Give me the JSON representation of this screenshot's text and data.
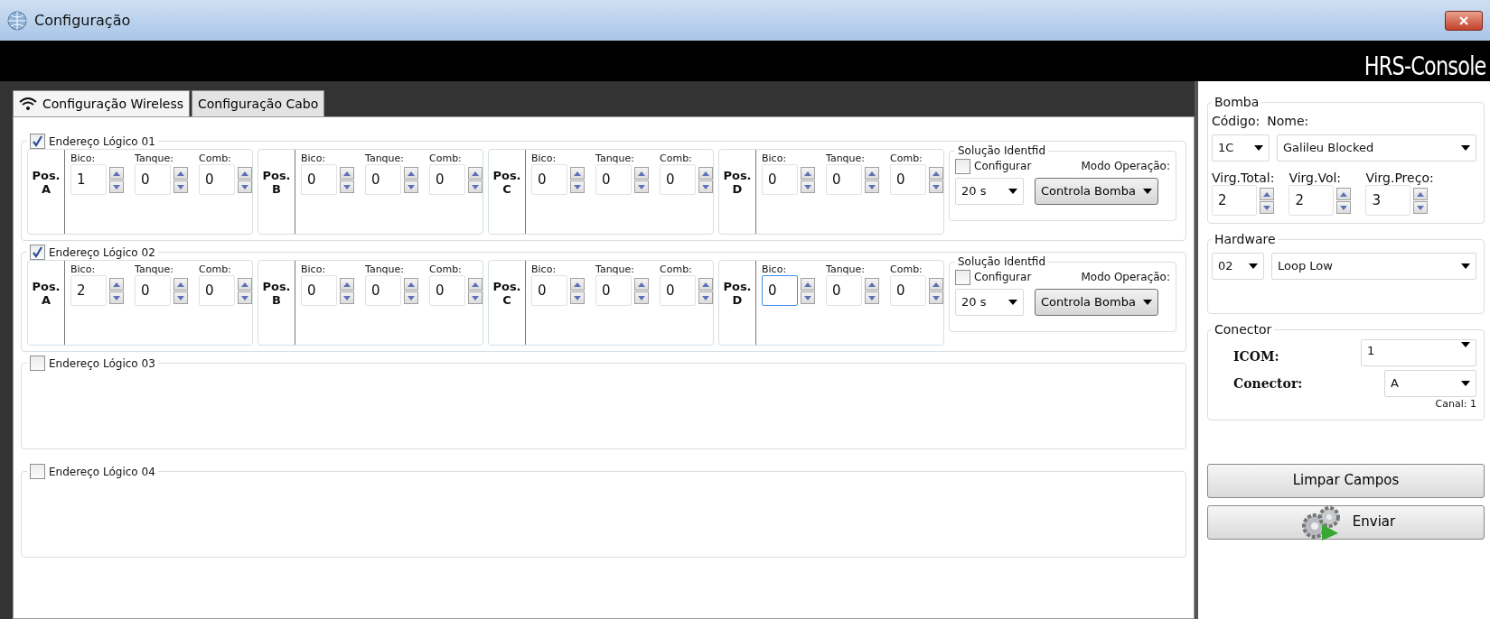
{
  "window": {
    "title": "Configuração"
  },
  "header": {
    "brand": "HRS-Console"
  },
  "tabs": [
    {
      "label": "Configuração Wireless",
      "selected": true,
      "kind": "wifi"
    },
    {
      "label": "Configuração Cabo",
      "selected": false,
      "kind": "plain"
    }
  ],
  "groups": [
    {
      "label": "Endereço Lógico 01",
      "checked": true,
      "positions": [
        {
          "pos_label": "Pos.",
          "letter": "A",
          "fields": [
            {
              "label": "Bico:",
              "value": "1",
              "focused": false
            },
            {
              "label": "Tanque:",
              "value": "0",
              "focused": false
            },
            {
              "label": "Comb:",
              "value": "0",
              "focused": false
            }
          ]
        },
        {
          "pos_label": "Pos.",
          "letter": "B",
          "fields": [
            {
              "label": "Bico:",
              "value": "0",
              "focused": false
            },
            {
              "label": "Tanque:",
              "value": "0",
              "focused": false
            },
            {
              "label": "Comb:",
              "value": "0",
              "focused": false
            }
          ]
        },
        {
          "pos_label": "Pos.",
          "letter": "C",
          "fields": [
            {
              "label": "Bico:",
              "value": "0",
              "focused": false
            },
            {
              "label": "Tanque:",
              "value": "0",
              "focused": false
            },
            {
              "label": "Comb:",
              "value": "0",
              "focused": false
            }
          ]
        },
        {
          "pos_label": "Pos.",
          "letter": "D",
          "fields": [
            {
              "label": "Bico:",
              "value": "0",
              "focused": false
            },
            {
              "label": "Tanque:",
              "value": "0",
              "focused": false
            },
            {
              "label": "Comb:",
              "value": "0",
              "focused": false
            }
          ]
        }
      ],
      "solution": {
        "legend": "Solução Identfid",
        "configure_label": "Configurar",
        "configure_checked": false,
        "mode_label": "Modo Operação:",
        "timeout": "20 s",
        "mode": "Controla Bomba"
      }
    },
    {
      "label": "Endereço Lógico 02",
      "checked": true,
      "positions": [
        {
          "pos_label": "Pos.",
          "letter": "A",
          "fields": [
            {
              "label": "Bico:",
              "value": "2",
              "focused": false
            },
            {
              "label": "Tanque:",
              "value": "0",
              "focused": false
            },
            {
              "label": "Comb:",
              "value": "0",
              "focused": false
            }
          ]
        },
        {
          "pos_label": "Pos.",
          "letter": "B",
          "fields": [
            {
              "label": "Bico:",
              "value": "0",
              "focused": false
            },
            {
              "label": "Tanque:",
              "value": "0",
              "focused": false
            },
            {
              "label": "Comb:",
              "value": "0",
              "focused": false
            }
          ]
        },
        {
          "pos_label": "Pos.",
          "letter": "C",
          "fields": [
            {
              "label": "Bico:",
              "value": "0",
              "focused": false
            },
            {
              "label": "Tanque:",
              "value": "0",
              "focused": false
            },
            {
              "label": "Comb:",
              "value": "0",
              "focused": false
            }
          ]
        },
        {
          "pos_label": "Pos.",
          "letter": "D",
          "fields": [
            {
              "label": "Bico:",
              "value": "0",
              "focused": true
            },
            {
              "label": "Tanque:",
              "value": "0",
              "focused": false
            },
            {
              "label": "Comb:",
              "value": "0",
              "focused": false
            }
          ]
        }
      ],
      "solution": {
        "legend": "Solução Identfid",
        "configure_label": "Configurar",
        "configure_checked": false,
        "mode_label": "Modo Operação:",
        "timeout": "20 s",
        "mode": "Controla Bomba"
      }
    },
    {
      "label": "Endereço Lógico 03",
      "checked": false
    },
    {
      "label": "Endereço Lógico 04",
      "checked": false
    }
  ],
  "bomba": {
    "legend": "Bomba",
    "code_label": "Código:",
    "name_label": "Nome:",
    "code": "1C",
    "name": "Galileu Blocked",
    "spinners": [
      {
        "label": "Virg.Total:",
        "value": "2"
      },
      {
        "label": "Virg.Vol:",
        "value": "2"
      },
      {
        "label": "Virg.Preço:",
        "value": "3"
      }
    ]
  },
  "hardware": {
    "legend": "Hardware",
    "code": "02",
    "model": "Loop Low"
  },
  "conector": {
    "legend": "Conector",
    "icom_label": "ICOM:",
    "icom": "1",
    "conector_label": "Conector:",
    "conector": "A",
    "canal": "Canal: 1"
  },
  "buttons": [
    {
      "label": "Limpar Campos",
      "kind": "plain"
    },
    {
      "label": "Enviar",
      "kind": "gears"
    }
  ]
}
